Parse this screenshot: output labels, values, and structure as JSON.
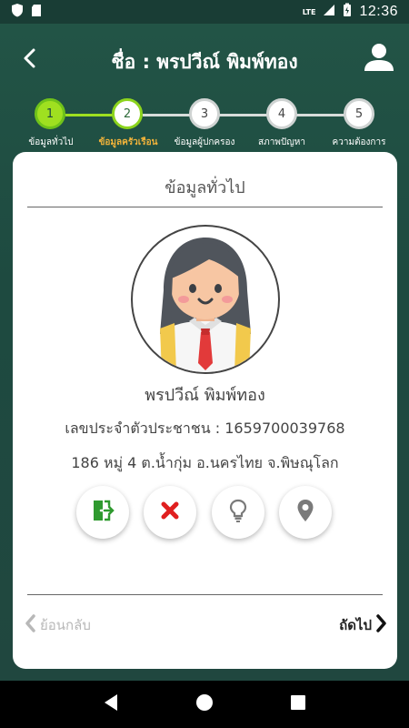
{
  "status_bar": {
    "time": "12:36",
    "network": "LTE"
  },
  "header": {
    "title": "ชื่อ : พรปวีณ์ พิมพ์ทอง"
  },
  "steps": [
    {
      "number": "1",
      "label": "ข้อมูลทั่วไป",
      "state": "done"
    },
    {
      "number": "2",
      "label": "ข้อมูลครัวเรือน",
      "state": "active"
    },
    {
      "number": "3",
      "label": "ข้อมูลผู้ปกครอง",
      "state": "todo"
    },
    {
      "number": "4",
      "label": "สภาพปัญหา",
      "state": "todo"
    },
    {
      "number": "5",
      "label": "ความต้องการ",
      "state": "todo"
    }
  ],
  "card": {
    "title": "ข้อมูลทั่วไป",
    "name": "พรปวีณ์ พิมพ์ทอง",
    "id_line": "เลขประจำตัวประชาชน : 1659700039768",
    "address": "186 หมู่ 4 ต.น้ำกุ่ม อ.นครไทย จ.พิษณุโลก",
    "actions": [
      {
        "icon": "exit-door-icon",
        "color": "#2f9a2f"
      },
      {
        "icon": "close-x-icon",
        "color": "#e01f1f"
      },
      {
        "icon": "lightbulb-icon",
        "color": "#7a7a7a"
      },
      {
        "icon": "location-pin-icon",
        "color": "#7a7a7a"
      }
    ],
    "prev_label": "ย้อนกลับ",
    "next_label": "ถัดไป"
  },
  "colors": {
    "background": "#1f4a40",
    "step_done": "#9fe020",
    "current_step_label": "#f2b33a"
  }
}
